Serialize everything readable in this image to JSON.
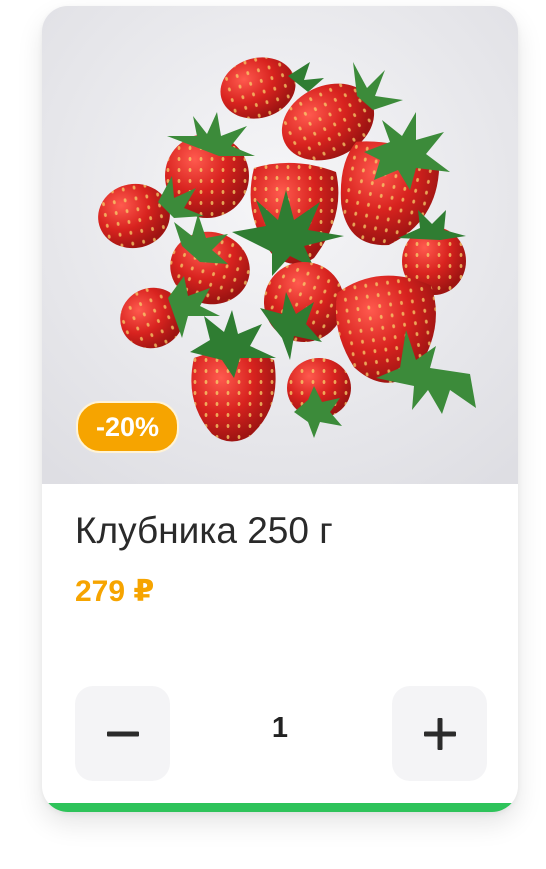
{
  "product": {
    "image_alt": "strawberries",
    "discount_badge": "-20%",
    "title": "Клубника 250 г",
    "price": "279 ₽"
  },
  "stepper": {
    "minus_icon": "minus-icon",
    "plus_icon": "plus-icon",
    "quantity": "1"
  },
  "colors": {
    "accent": "#f6a400",
    "bottom_bar": "#2ec35a",
    "strawberry": "#d8231f",
    "leaf": "#2f7d32"
  }
}
